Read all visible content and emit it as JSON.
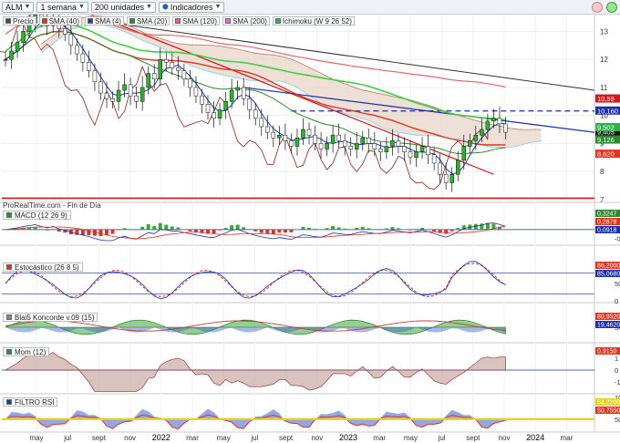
{
  "toolbar": {
    "symbol": "ALM",
    "period": "1 semana",
    "units": "200 unidades",
    "indicators": "Indicadores"
  },
  "legend": [
    {
      "label": "Precio",
      "color": "#4a4a4a"
    },
    {
      "label": "SMA (40)",
      "color": "#e0341f"
    },
    {
      "label": "SMA (4)",
      "color": "#1a3fa8"
    },
    {
      "label": "SMA (20)",
      "color": "#2f8a2f"
    },
    {
      "label": "SMA (120)",
      "color": "#e06a6a"
    },
    {
      "label": "SMA (200)",
      "color": "#ff66cc"
    },
    {
      "label": "Ichimoku (W 9 26 52)",
      "color": "#2fb24a"
    }
  ],
  "footer_note": "ProRealTime.com - Fin de Día",
  "chart_data": [
    {
      "type": "line",
      "name": "price",
      "x_ticks": [
        "may",
        "jul",
        "sept",
        "nov",
        "2022",
        "mar",
        "may",
        "jul",
        "sept",
        "nov",
        "2023",
        "mar",
        "may",
        "jul",
        "sept",
        "nov",
        "2024",
        "mar"
      ],
      "y_ticks": [
        7,
        8,
        9,
        10,
        11,
        12,
        13
      ],
      "ylim": [
        6.9,
        13.6
      ],
      "closes": [
        12.0,
        12.3,
        12.6,
        13.0,
        13.3,
        13.6,
        13.4,
        13.2,
        13.5,
        13.1,
        12.9,
        12.5,
        12.2,
        11.9,
        11.6,
        11.2,
        10.8,
        10.6,
        10.5,
        10.9,
        11.1,
        10.7,
        10.5,
        11.0,
        11.5,
        11.3,
        12.0,
        11.9,
        11.7,
        11.6,
        11.3,
        11.0,
        10.7,
        10.4,
        10.1,
        9.9,
        10.2,
        10.5,
        10.9,
        11.0,
        10.6,
        10.2,
        9.9,
        9.6,
        9.4,
        9.2,
        9.3,
        9.1,
        8.9,
        9.2,
        9.5,
        9.3,
        9.0,
        8.8,
        9.0,
        9.3,
        9.1,
        8.9,
        8.8,
        9.0,
        9.2,
        9.0,
        8.8,
        8.7,
        8.9,
        9.1,
        8.9,
        8.7,
        8.5,
        8.7,
        8.9,
        8.6,
        8.3,
        7.9,
        7.6,
        7.9,
        8.4,
        8.9,
        9.1,
        9.3,
        9.5,
        9.8,
        9.9,
        9.7,
        9.4
      ],
      "last_values": [
        "10,59",
        "10,160",
        "9,405",
        "9,502",
        "9,126",
        "8,620"
      ],
      "annotations": {
        "horizontal_dashed": 10.16,
        "hline_red": 7.05
      }
    },
    {
      "type": "line",
      "name": "MACD (12 26 9)",
      "y_ticks": [
        "1",
        "0,5",
        "0",
        "-0,5"
      ],
      "last_values": [
        "0,3247",
        "0,2878",
        "0,0918"
      ]
    },
    {
      "type": "line",
      "name": "Estocástico (26 8 5)",
      "y_ticks": [
        "100",
        "50",
        "0"
      ],
      "last_values": [
        "86,2000",
        "85,0680"
      ]
    },
    {
      "type": "area",
      "name": "Blai5 Koncorde v.09 (15)",
      "y_ticks": [
        "100",
        "50"
      ],
      "last_values": [
        "80,9520",
        "19,4620"
      ]
    },
    {
      "type": "area",
      "name": "Mom (12)",
      "y_ticks": [
        "1",
        "0",
        "-1"
      ],
      "last_values": [
        "0,9150"
      ]
    },
    {
      "type": "area",
      "name": "FILTRO RSI",
      "y_ticks": [
        "100",
        "50"
      ],
      "last_values": [
        "54,2200",
        "50,7550"
      ]
    }
  ]
}
